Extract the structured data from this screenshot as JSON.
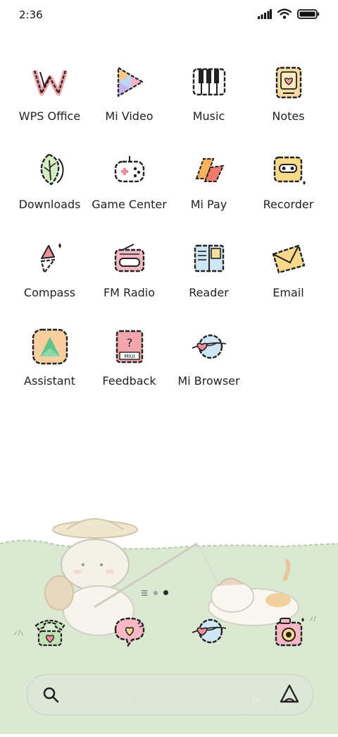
{
  "status_bar": {
    "time": "2:36",
    "icons": [
      "signal-icon",
      "wifi-icon",
      "battery-icon"
    ]
  },
  "apps": [
    {
      "label": "WPS Office",
      "icon": "wps-office-icon"
    },
    {
      "label": "Mi Video",
      "icon": "mi-video-icon"
    },
    {
      "label": "Music",
      "icon": "music-icon"
    },
    {
      "label": "Notes",
      "icon": "notes-icon"
    },
    {
      "label": "Downloads",
      "icon": "downloads-icon"
    },
    {
      "label": "Game Center",
      "icon": "game-center-icon"
    },
    {
      "label": "Mi Pay",
      "icon": "mi-pay-icon"
    },
    {
      "label": "Recorder",
      "icon": "recorder-icon"
    },
    {
      "label": "Compass",
      "icon": "compass-icon"
    },
    {
      "label": "FM Radio",
      "icon": "fm-radio-icon"
    },
    {
      "label": "Reader",
      "icon": "reader-icon"
    },
    {
      "label": "Email",
      "icon": "email-icon"
    },
    {
      "label": "Assistant",
      "icon": "assistant-icon"
    },
    {
      "label": "Feedback",
      "icon": "feedback-icon"
    },
    {
      "label": "Mi Browser",
      "icon": "mi-browser-icon"
    }
  ],
  "page_indicator": {
    "pages": 3,
    "current": 3
  },
  "dock": [
    {
      "icon": "phone-icon"
    },
    {
      "icon": "messages-icon"
    },
    {
      "icon": "browser-icon"
    },
    {
      "icon": "camera-icon"
    }
  ],
  "search": {
    "icon": "search-icon",
    "assistant_icon": "assistant-triangle-icon"
  },
  "colors": {
    "background": "#ffffff",
    "grass": "#d9e6d0",
    "search_bar": "#dce6d8"
  }
}
